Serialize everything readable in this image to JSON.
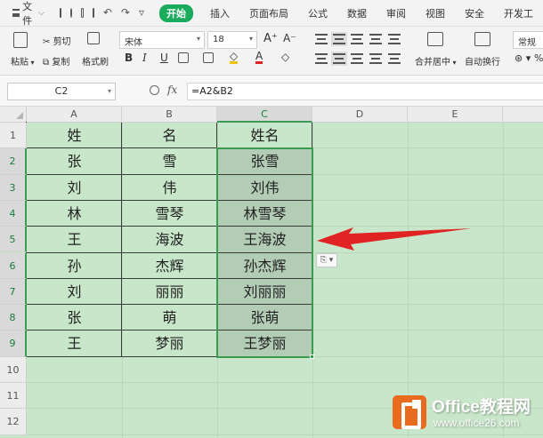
{
  "menubar": {
    "file_label": "文件",
    "tabs": [
      {
        "label": "开始",
        "active": true
      },
      {
        "label": "插入",
        "active": false
      },
      {
        "label": "页面布局",
        "active": false
      },
      {
        "label": "公式",
        "active": false
      },
      {
        "label": "数据",
        "active": false
      },
      {
        "label": "审阅",
        "active": false
      },
      {
        "label": "视图",
        "active": false
      },
      {
        "label": "安全",
        "active": false
      },
      {
        "label": "开发工",
        "active": false
      }
    ]
  },
  "ribbon": {
    "paste_label": "粘贴",
    "cut_label": "剪切",
    "copy_label": "复制",
    "format_painter_label": "格式刷",
    "font_name": "宋体",
    "font_size": "18",
    "merge_center_label": "合并居中",
    "wrap_text_label": "自动换行",
    "number_format": "常规"
  },
  "formula_bar": {
    "name_box": "C2",
    "fx_label": "fx",
    "formula": "=A2&B2"
  },
  "sheet": {
    "columns": [
      "A",
      "B",
      "C",
      "D",
      "E"
    ],
    "rows": [
      "1",
      "2",
      "3",
      "4",
      "5",
      "6",
      "7",
      "8",
      "9",
      "10",
      "11",
      "12"
    ],
    "selected_column": "C",
    "selected_rows": [
      "2",
      "3",
      "4",
      "5",
      "6",
      "7",
      "8",
      "9"
    ],
    "data": [
      [
        "姓",
        "名",
        "姓名"
      ],
      [
        "张",
        "雪",
        "张雪"
      ],
      [
        "刘",
        "伟",
        "刘伟"
      ],
      [
        "林",
        "雪琴",
        "林雪琴"
      ],
      [
        "王",
        "海波",
        "王海波"
      ],
      [
        "孙",
        "杰辉",
        "孙杰辉"
      ],
      [
        "刘",
        "丽丽",
        "刘丽丽"
      ],
      [
        "张",
        "萌",
        "张萌"
      ],
      [
        "王",
        "梦丽",
        "王梦丽"
      ]
    ]
  },
  "colors": {
    "accent": "#1aab5d",
    "sheet_background": "#c8e6c9",
    "selection_border": "#3a9a4e",
    "arrow": "#e02424"
  },
  "watermark": {
    "title": "Office教程网",
    "url": "www.office26.com"
  }
}
